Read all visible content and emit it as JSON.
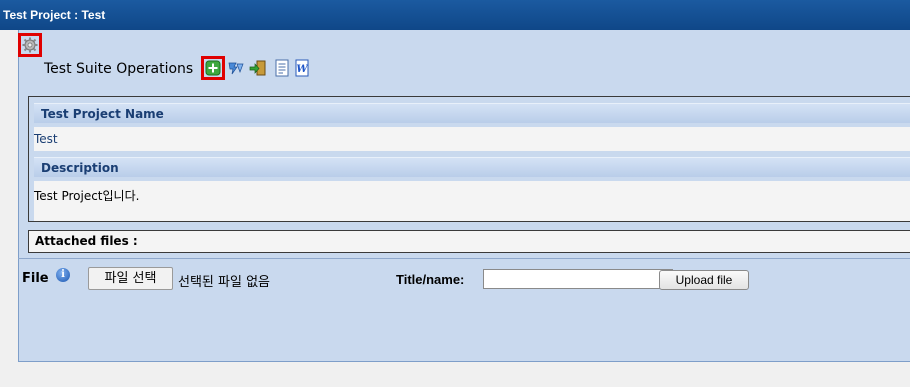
{
  "title_bar": {
    "text": "Test Project : Test"
  },
  "toolbar": {
    "label": "Test Suite Operations",
    "icons": [
      "gear-icon",
      "add-icon",
      "translate-icon",
      "import-icon",
      "report-icon",
      "word-export-icon"
    ]
  },
  "project": {
    "name_header": "Test Project Name",
    "name_value": "Test",
    "description_header": "Description",
    "description_value": "Test Project입니다."
  },
  "attachments": {
    "header": "Attached files :"
  },
  "upload": {
    "file_label": "File",
    "info_icon_glyph": "i",
    "choose_button": "파일 선택",
    "no_file_text": "선택된 파일 없음",
    "title_label": "Title/name:",
    "title_value": "",
    "upload_button": "Upload file"
  },
  "colors": {
    "title_bar": "#0f4788",
    "panel": "#c9d9ee",
    "section_header_text": "#1a3e73",
    "highlight": "#e00000"
  }
}
